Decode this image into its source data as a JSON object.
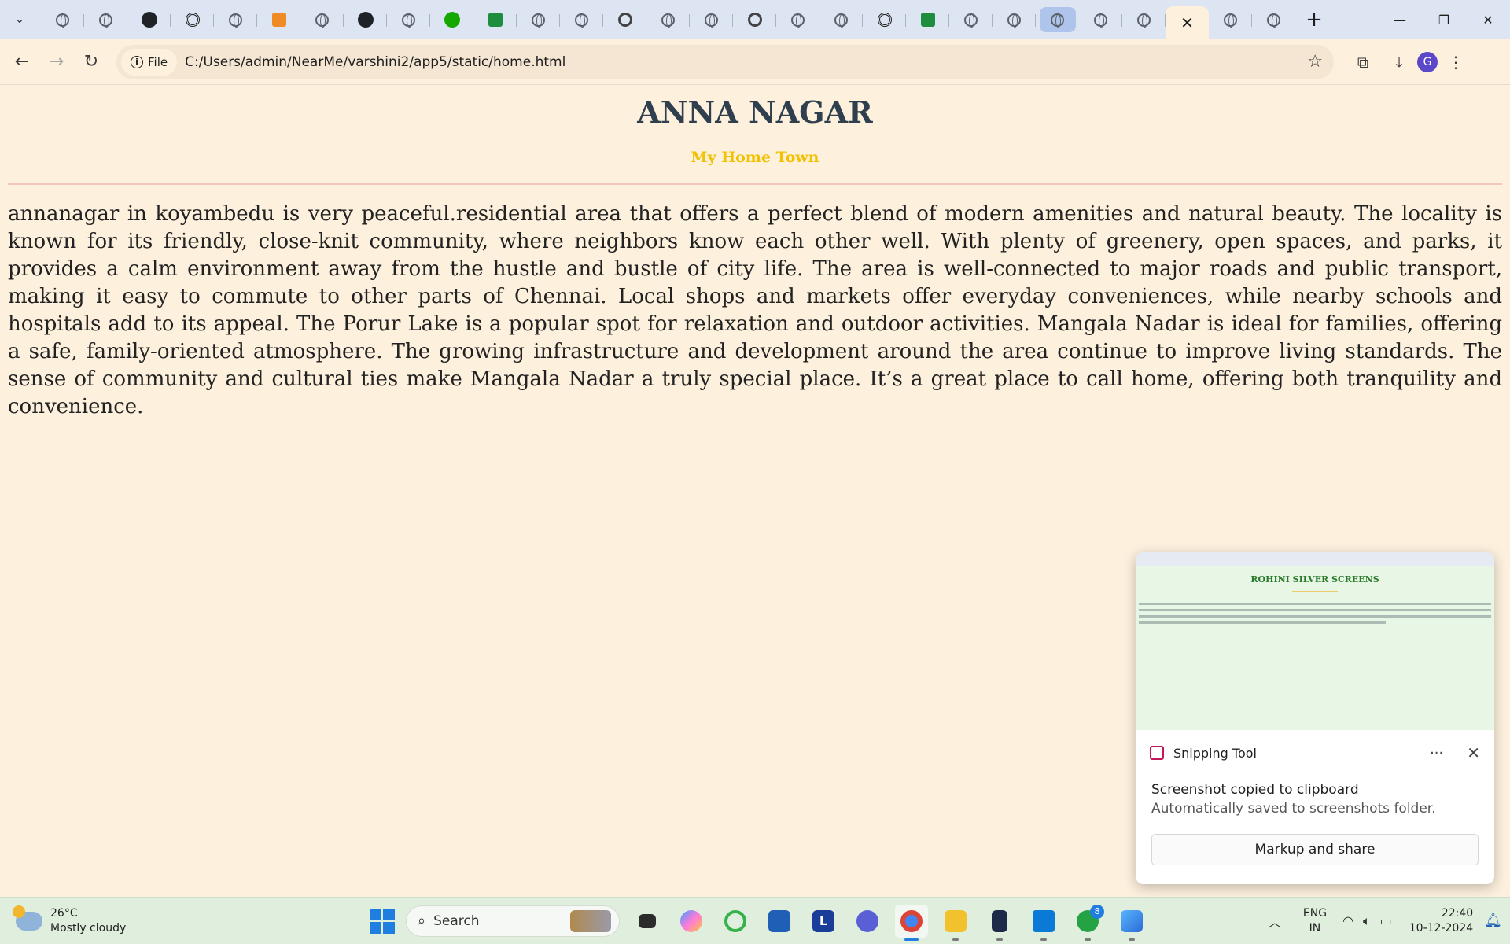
{
  "browser": {
    "address_chip": "File",
    "url": "C:/Users/admin/NearMe/varshini2/app5/static/home.html",
    "tab_favicons": [
      "globe-icon",
      "globe-icon",
      "github-icon",
      "chatgpt-icon",
      "globe-icon",
      "marketing-icon",
      "globe-icon",
      "github-icon",
      "globe-icon",
      "upwork-icon",
      "sheets-icon",
      "globe-icon",
      "globe-icon",
      "chrome-icon",
      "globe-icon",
      "globe-icon",
      "chrome-icon",
      "globe-icon",
      "globe-icon",
      "chatgpt-icon",
      "sheets-icon",
      "globe-icon",
      "globe-icon",
      "globe-icon",
      "globe-icon",
      "globe-icon",
      "active-close",
      "globe-icon",
      "globe-icon"
    ],
    "highlighted_tab_index": 23,
    "active_tab_index": 26,
    "profile_initial": "G"
  },
  "page": {
    "title": "ANNA NAGAR",
    "subtitle": "My Home Town",
    "body": "annanagar in koyambedu is very peaceful.residential area that offers a perfect blend of modern amenities and natural beauty. The locality is known for its friendly, close-knit community, where neighbors know each other well. With plenty of greenery, open spaces, and parks, it provides a calm environment away from the hustle and bustle of city life. The area is well-connected to major roads and public transport, making it easy to commute to other parts of Chennai. Local shops and markets offer everyday conveniences, while nearby schools and hospitals add to its appeal. The Porur Lake is a popular spot for relaxation and outdoor activities. Mangala Nadar is ideal for families, offering a safe, family-oriented atmosphere. The growing infrastructure and development around the area continue to improve living standards. The sense of community and cultural ties make Mangala Nadar a truly special place. It’s a great place to call home, offering both tranquility and convenience.",
    "title_color": "#2f3f4d",
    "subtitle_color": "#f2c200",
    "background": "#fdf0dd"
  },
  "toast": {
    "app_name": "Snipping Tool",
    "message": "Screenshot copied to clipboard",
    "detail": "Automatically saved to screenshots folder.",
    "action": "Markup and share",
    "more": "···",
    "thumbnail_title": "ROHINI SILVER SCREENS"
  },
  "taskbar": {
    "temperature": "26°C",
    "weather": "Mostly cloudy",
    "search_placeholder": "Search",
    "whatsapp_badge": "8",
    "lang_line1": "ENG",
    "lang_line2": "IN",
    "time": "22:40",
    "date": "10-12-2024"
  }
}
